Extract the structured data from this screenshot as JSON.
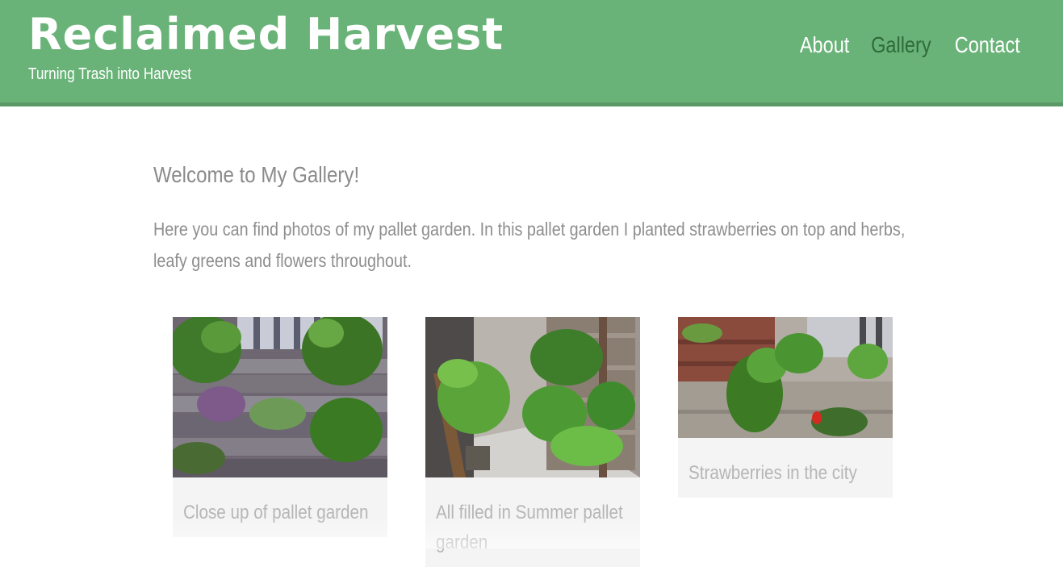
{
  "header": {
    "title": "Reclaimed Harvest",
    "tagline": "Turning Trash into Harvest",
    "colors": {
      "background": "#69b378",
      "border": "#5b9867",
      "active_link": "#2f6b3a"
    }
  },
  "nav": {
    "items": [
      {
        "label": "About",
        "active": false
      },
      {
        "label": "Gallery",
        "active": true
      },
      {
        "label": "Contact",
        "active": false
      }
    ]
  },
  "main": {
    "heading": "Welcome to My Gallery!",
    "intro": "Here you can find photos of my pallet garden. In this pallet garden I planted strawberries on top and herbs, leafy greens and flowers throughout."
  },
  "gallery": {
    "items": [
      {
        "caption": "Close up of pallet garden",
        "image": "pallet-garden-closeup-photo"
      },
      {
        "caption": "All filled in Summer pallet garden",
        "image": "summer-pallet-garden-photo"
      },
      {
        "caption": "Strawberries in the city",
        "image": "strawberries-photo"
      }
    ]
  }
}
